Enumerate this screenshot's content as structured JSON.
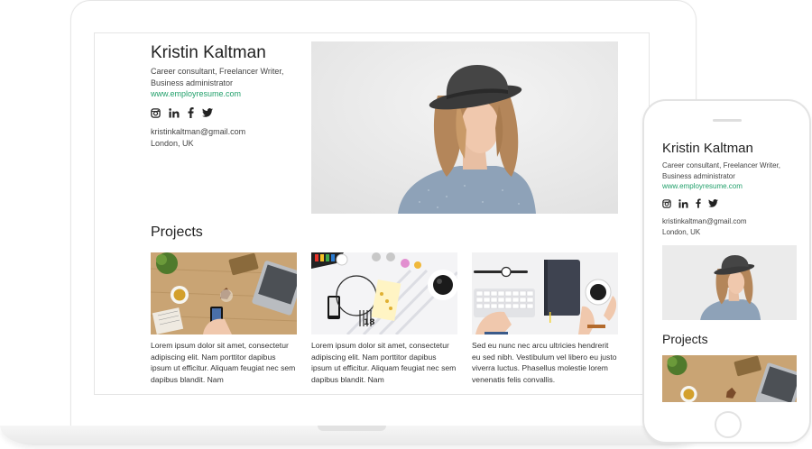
{
  "profile": {
    "name": "Kristin Kaltman",
    "role_line1": "Career consultant, Freelancer Writer,",
    "role_line2": "Business administrator",
    "website": "www.employresume.com",
    "email": "kristinkaltman@gmail.com",
    "location": "London, UK",
    "social_icons": [
      "instagram-icon",
      "linkedin-icon",
      "facebook-icon",
      "twitter-icon"
    ]
  },
  "projects": {
    "heading": "Projects",
    "items": [
      {
        "text": "Lorem ipsum dolor sit amet, consectetur adipiscing elit. Nam porttitor dapibus ipsum ut efficitur. Aliquam feugiat nec sem dapibus blandit. Nam"
      },
      {
        "text": "Lorem ipsum dolor sit amet, consectetur adipiscing elit. Nam porttitor dapibus ipsum ut efficitur. Aliquam feugiat nec sem dapibus blandit. Nam"
      },
      {
        "text": "Sed eu nunc nec arcu ultricies hendrerit eu sed nibh. Vestibulum vel libero eu justo viverra luctus. Phasellus molestie lorem venenatis felis convallis."
      }
    ]
  },
  "colors": {
    "link": "#22a06b",
    "text": "#333333",
    "device_frame": "#e3e3e3"
  }
}
